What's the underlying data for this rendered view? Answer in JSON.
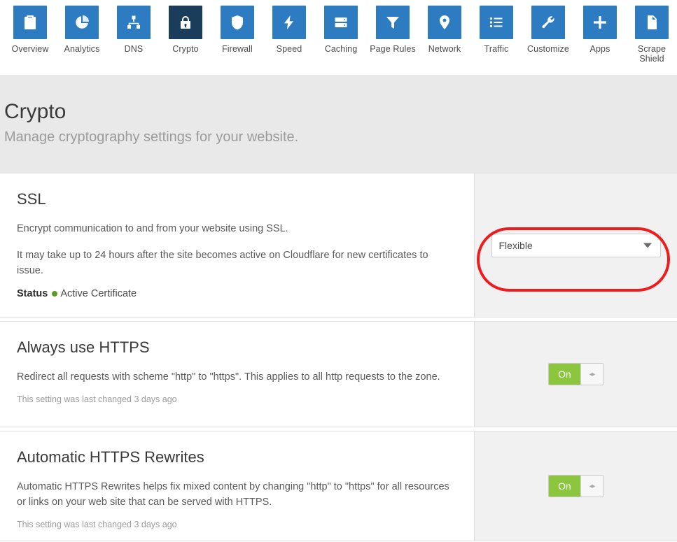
{
  "nav": {
    "items": [
      {
        "label": "Overview",
        "icon": "clipboard-icon",
        "active": false
      },
      {
        "label": "Analytics",
        "icon": "pie-chart-icon",
        "active": false
      },
      {
        "label": "DNS",
        "icon": "sitemap-icon",
        "active": false
      },
      {
        "label": "Crypto",
        "icon": "lock-icon",
        "active": true
      },
      {
        "label": "Firewall",
        "icon": "shield-icon",
        "active": false
      },
      {
        "label": "Speed",
        "icon": "bolt-icon",
        "active": false
      },
      {
        "label": "Caching",
        "icon": "server-icon",
        "active": false
      },
      {
        "label": "Page Rules",
        "icon": "funnel-icon",
        "active": false
      },
      {
        "label": "Network",
        "icon": "map-pin-icon",
        "active": false
      },
      {
        "label": "Traffic",
        "icon": "list-icon",
        "active": false
      },
      {
        "label": "Customize",
        "icon": "wrench-icon",
        "active": false
      },
      {
        "label": "Apps",
        "icon": "plus-icon",
        "active": false
      },
      {
        "label": "Scrape\nShield",
        "icon": "document-icon",
        "active": false
      }
    ]
  },
  "header": {
    "title": "Crypto",
    "subtitle": "Manage cryptography settings for your website."
  },
  "cards": [
    {
      "title": "SSL",
      "text1": "Encrypt communication to and from your website using SSL.",
      "text2": "It may take up to 24 hours after the site becomes active on Cloudflare for new certificates to issue.",
      "status_label": "Status",
      "status_value": "Active Certificate",
      "control": "select",
      "select_value": "Flexible"
    },
    {
      "title": "Always use HTTPS",
      "text1": "Redirect all requests with scheme \"http\" to \"https\". This applies to all http requests to the zone.",
      "meta": "This setting was last changed 3 days ago",
      "control": "toggle",
      "toggle_label": "On"
    },
    {
      "title": "Automatic HTTPS Rewrites",
      "text1": "Automatic HTTPS Rewrites helps fix mixed content by changing \"http\" to \"https\" for all resources or links on your web site that can be served with HTTPS.",
      "meta": "This setting was last changed 3 days ago",
      "control": "toggle",
      "toggle_label": "On"
    }
  ],
  "annotation": {
    "target": "ssl-mode-select",
    "color": "#ee1c1c"
  },
  "colors": {
    "nav_tile": "#2d7cc1",
    "nav_tile_active": "#1b3d5c",
    "header_bg": "#e9e9e9",
    "toggle_on": "#8cc63e",
    "status_dot": "#5c9c21",
    "annotation": "#ee1c1c"
  }
}
